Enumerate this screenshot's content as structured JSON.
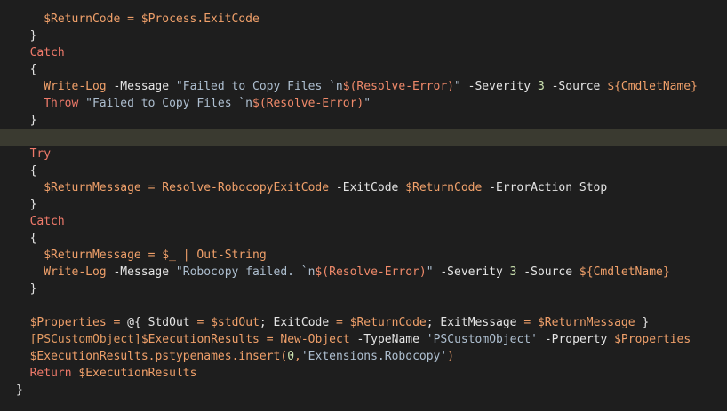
{
  "editor": {
    "lines": [
      {
        "indent": 8,
        "tokens": [
          {
            "t": "var",
            "v": "$ReturnCode"
          },
          {
            "t": "plain",
            "v": " "
          },
          {
            "t": "var",
            "v": "="
          },
          {
            "t": "plain",
            "v": " "
          },
          {
            "t": "var",
            "v": "$Process.ExitCode"
          }
        ]
      },
      {
        "indent": 4,
        "tokens": [
          {
            "t": "plain",
            "v": "}"
          }
        ]
      },
      {
        "indent": 4,
        "tokens": [
          {
            "t": "kw",
            "v": "Catch"
          }
        ]
      },
      {
        "indent": 4,
        "tokens": [
          {
            "t": "plain",
            "v": "{"
          }
        ]
      },
      {
        "indent": 8,
        "tokens": [
          {
            "t": "var",
            "v": "Write-Log"
          },
          {
            "t": "plain",
            "v": " "
          },
          {
            "t": "par",
            "v": "-Message"
          },
          {
            "t": "plain",
            "v": " "
          },
          {
            "t": "str",
            "v": "\"Failed to Copy Files `n"
          },
          {
            "t": "sub",
            "v": "$(Resolve-Error)"
          },
          {
            "t": "str",
            "v": "\""
          },
          {
            "t": "plain",
            "v": " "
          },
          {
            "t": "par",
            "v": "-Severity"
          },
          {
            "t": "plain",
            "v": " "
          },
          {
            "t": "num",
            "v": "3"
          },
          {
            "t": "plain",
            "v": " "
          },
          {
            "t": "par",
            "v": "-Source"
          },
          {
            "t": "plain",
            "v": " "
          },
          {
            "t": "var",
            "v": "${CmdletName}"
          }
        ]
      },
      {
        "indent": 8,
        "tokens": [
          {
            "t": "kw",
            "v": "Throw"
          },
          {
            "t": "plain",
            "v": " "
          },
          {
            "t": "str",
            "v": "\"Failed to Copy Files `n"
          },
          {
            "t": "sub",
            "v": "$(Resolve-Error)"
          },
          {
            "t": "str",
            "v": "\""
          }
        ]
      },
      {
        "indent": 4,
        "tokens": [
          {
            "t": "plain",
            "v": "}"
          }
        ]
      },
      {
        "indent": 0,
        "current": true,
        "tokens": []
      },
      {
        "indent": 4,
        "tokens": [
          {
            "t": "kw",
            "v": "Try"
          }
        ]
      },
      {
        "indent": 4,
        "tokens": [
          {
            "t": "plain",
            "v": "{"
          }
        ]
      },
      {
        "indent": 8,
        "tokens": [
          {
            "t": "var",
            "v": "$ReturnMessage"
          },
          {
            "t": "plain",
            "v": " "
          },
          {
            "t": "var",
            "v": "="
          },
          {
            "t": "plain",
            "v": " "
          },
          {
            "t": "var",
            "v": "Resolve-RobocopyExitCode"
          },
          {
            "t": "plain",
            "v": " "
          },
          {
            "t": "par",
            "v": "-ExitCode"
          },
          {
            "t": "plain",
            "v": " "
          },
          {
            "t": "var",
            "v": "$ReturnCode"
          },
          {
            "t": "plain",
            "v": " "
          },
          {
            "t": "par",
            "v": "-ErrorAction"
          },
          {
            "t": "plain",
            "v": " "
          },
          {
            "t": "par",
            "v": "Stop"
          }
        ]
      },
      {
        "indent": 4,
        "tokens": [
          {
            "t": "plain",
            "v": "}"
          }
        ]
      },
      {
        "indent": 4,
        "tokens": [
          {
            "t": "kw",
            "v": "Catch"
          }
        ]
      },
      {
        "indent": 4,
        "tokens": [
          {
            "t": "plain",
            "v": "{"
          }
        ]
      },
      {
        "indent": 8,
        "tokens": [
          {
            "t": "var",
            "v": "$ReturnMessage"
          },
          {
            "t": "plain",
            "v": " "
          },
          {
            "t": "var",
            "v": "="
          },
          {
            "t": "plain",
            "v": " "
          },
          {
            "t": "var",
            "v": "$_"
          },
          {
            "t": "plain",
            "v": " "
          },
          {
            "t": "var",
            "v": "|"
          },
          {
            "t": "plain",
            "v": " "
          },
          {
            "t": "var",
            "v": "Out-String"
          }
        ]
      },
      {
        "indent": 8,
        "tokens": [
          {
            "t": "var",
            "v": "Write-Log"
          },
          {
            "t": "plain",
            "v": " "
          },
          {
            "t": "par",
            "v": "-Message"
          },
          {
            "t": "plain",
            "v": " "
          },
          {
            "t": "str",
            "v": "\"Robocopy failed. `n"
          },
          {
            "t": "sub",
            "v": "$(Resolve-Error)"
          },
          {
            "t": "str",
            "v": "\""
          },
          {
            "t": "plain",
            "v": " "
          },
          {
            "t": "par",
            "v": "-Severity"
          },
          {
            "t": "plain",
            "v": " "
          },
          {
            "t": "num",
            "v": "3"
          },
          {
            "t": "plain",
            "v": " "
          },
          {
            "t": "par",
            "v": "-Source"
          },
          {
            "t": "plain",
            "v": " "
          },
          {
            "t": "var",
            "v": "${CmdletName}"
          }
        ]
      },
      {
        "indent": 4,
        "tokens": [
          {
            "t": "plain",
            "v": "}"
          }
        ]
      },
      {
        "indent": 0,
        "tokens": []
      },
      {
        "indent": 4,
        "tokens": [
          {
            "t": "var",
            "v": "$Properties"
          },
          {
            "t": "plain",
            "v": " "
          },
          {
            "t": "var",
            "v": "="
          },
          {
            "t": "plain",
            "v": " "
          },
          {
            "t": "plain",
            "v": "@{ StdOut "
          },
          {
            "t": "var",
            "v": "="
          },
          {
            "t": "plain",
            "v": " "
          },
          {
            "t": "var",
            "v": "$stdOut"
          },
          {
            "t": "plain",
            "v": "; ExitCode "
          },
          {
            "t": "var",
            "v": "="
          },
          {
            "t": "plain",
            "v": " "
          },
          {
            "t": "var",
            "v": "$ReturnCode"
          },
          {
            "t": "plain",
            "v": "; ExitMessage "
          },
          {
            "t": "var",
            "v": "="
          },
          {
            "t": "plain",
            "v": " "
          },
          {
            "t": "var",
            "v": "$ReturnMessage"
          },
          {
            "t": "plain",
            "v": " }"
          }
        ]
      },
      {
        "indent": 4,
        "tokens": [
          {
            "t": "type",
            "v": "[PSCustomObject]"
          },
          {
            "t": "var",
            "v": "$ExecutionResults"
          },
          {
            "t": "plain",
            "v": " "
          },
          {
            "t": "var",
            "v": "="
          },
          {
            "t": "plain",
            "v": " "
          },
          {
            "t": "var",
            "v": "New-Object"
          },
          {
            "t": "plain",
            "v": " "
          },
          {
            "t": "par",
            "v": "-TypeName"
          },
          {
            "t": "plain",
            "v": " "
          },
          {
            "t": "str",
            "v": "'PSCustomObject'"
          },
          {
            "t": "plain",
            "v": " "
          },
          {
            "t": "par",
            "v": "-Property"
          },
          {
            "t": "plain",
            "v": " "
          },
          {
            "t": "var",
            "v": "$Properties"
          }
        ]
      },
      {
        "indent": 4,
        "tokens": [
          {
            "t": "var",
            "v": "$ExecutionResults.pstypenames.insert("
          },
          {
            "t": "num",
            "v": "0"
          },
          {
            "t": "var",
            "v": ","
          },
          {
            "t": "str",
            "v": "'Extensions.Robocopy'"
          },
          {
            "t": "var",
            "v": ")"
          }
        ]
      },
      {
        "indent": 4,
        "tokens": [
          {
            "t": "kw",
            "v": "Return"
          },
          {
            "t": "plain",
            "v": " "
          },
          {
            "t": "var",
            "v": "$ExecutionResults"
          }
        ]
      },
      {
        "indent": 0,
        "tokens": [
          {
            "t": "plain",
            "v": "}"
          }
        ]
      }
    ]
  }
}
